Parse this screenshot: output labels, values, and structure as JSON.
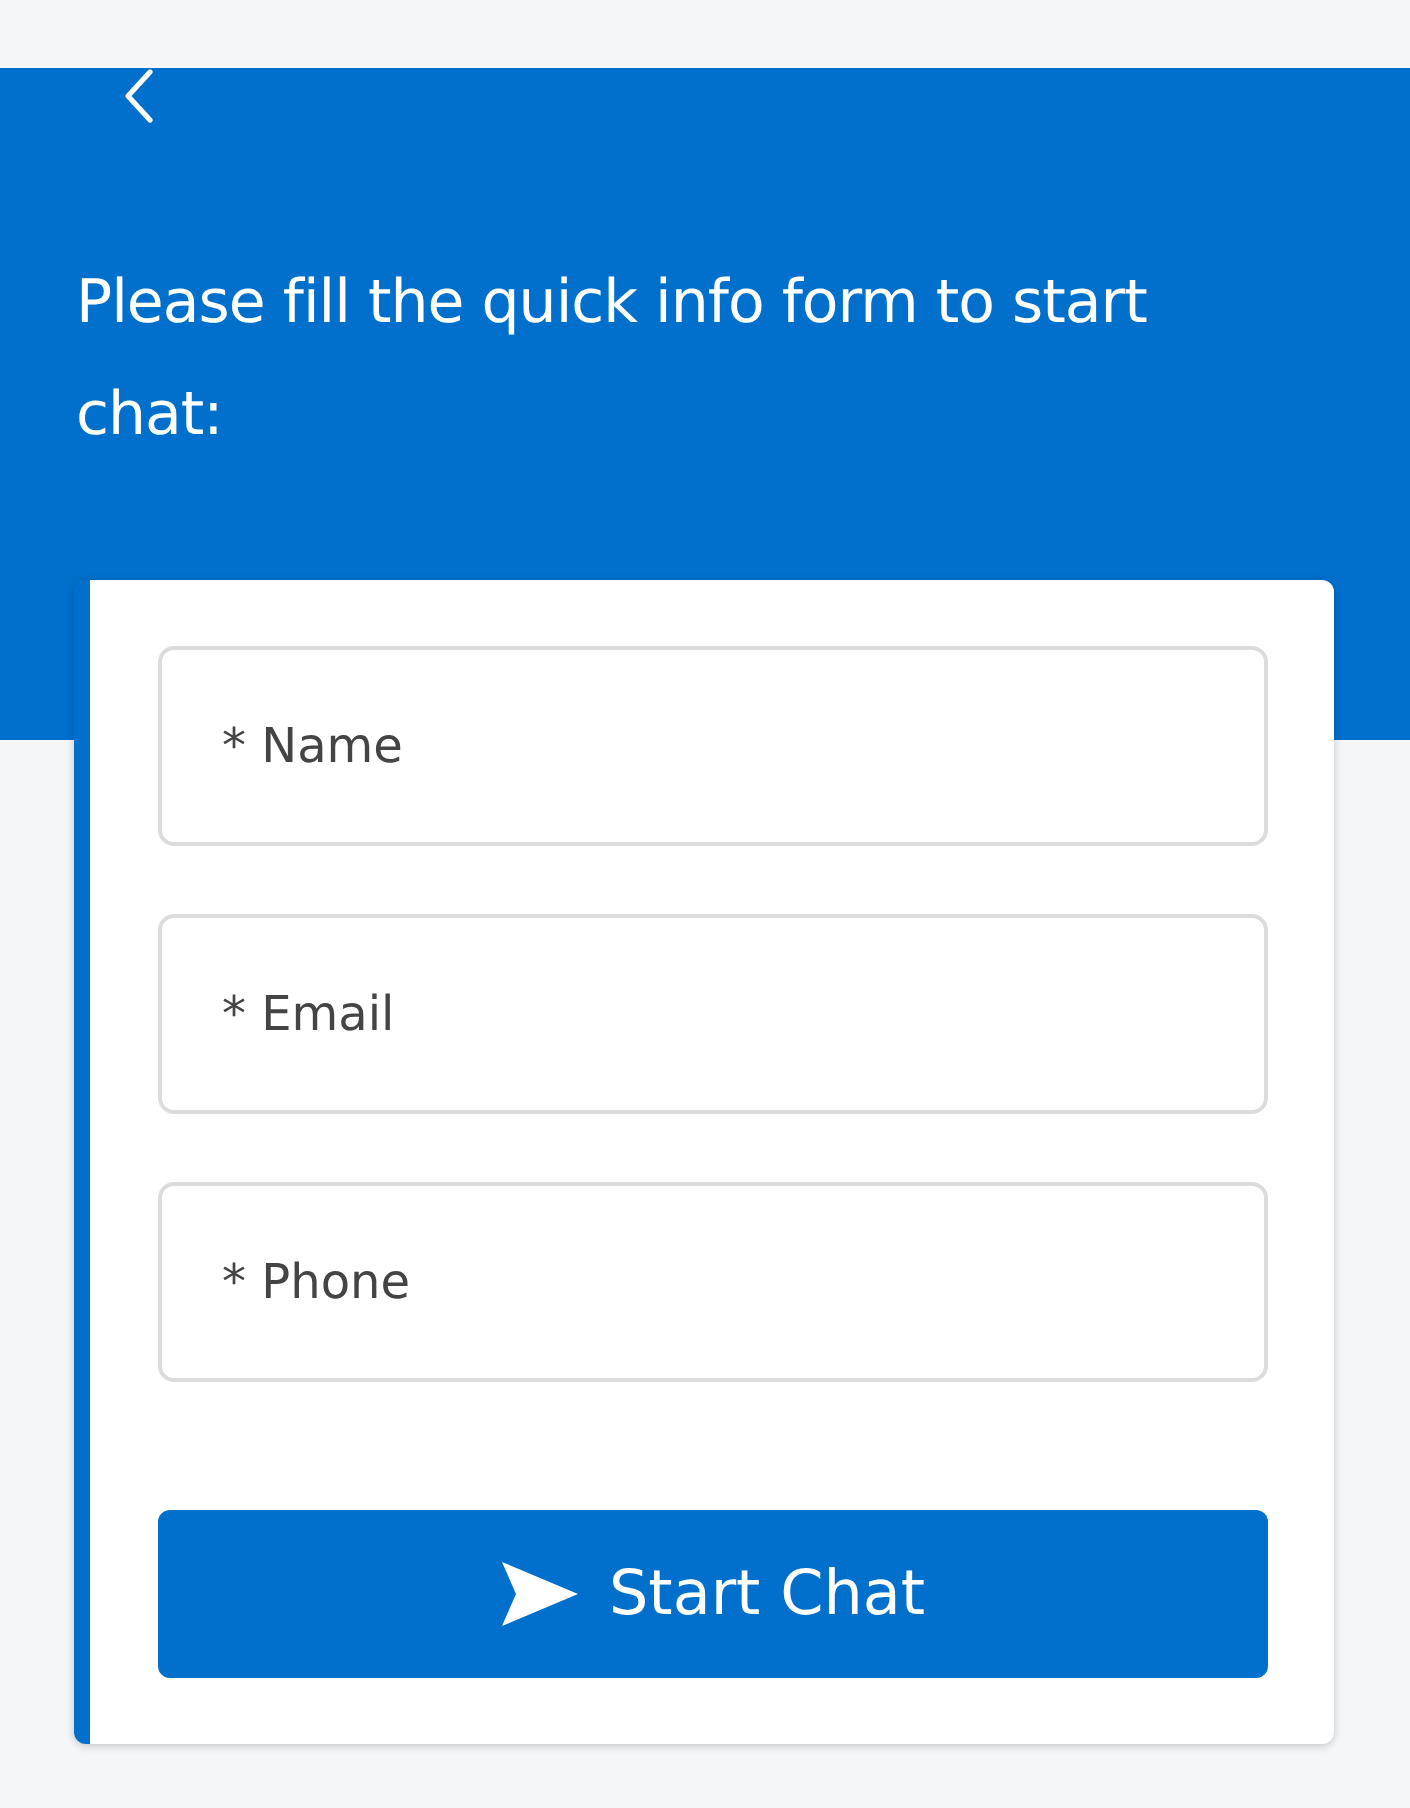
{
  "header": {
    "title": "Please fill the quick info form to start chat:"
  },
  "form": {
    "fields": [
      {
        "placeholder": "* Name"
      },
      {
        "placeholder": "* Email"
      },
      {
        "placeholder": "* Phone"
      }
    ],
    "submit": {
      "label": "Start Chat"
    }
  }
}
